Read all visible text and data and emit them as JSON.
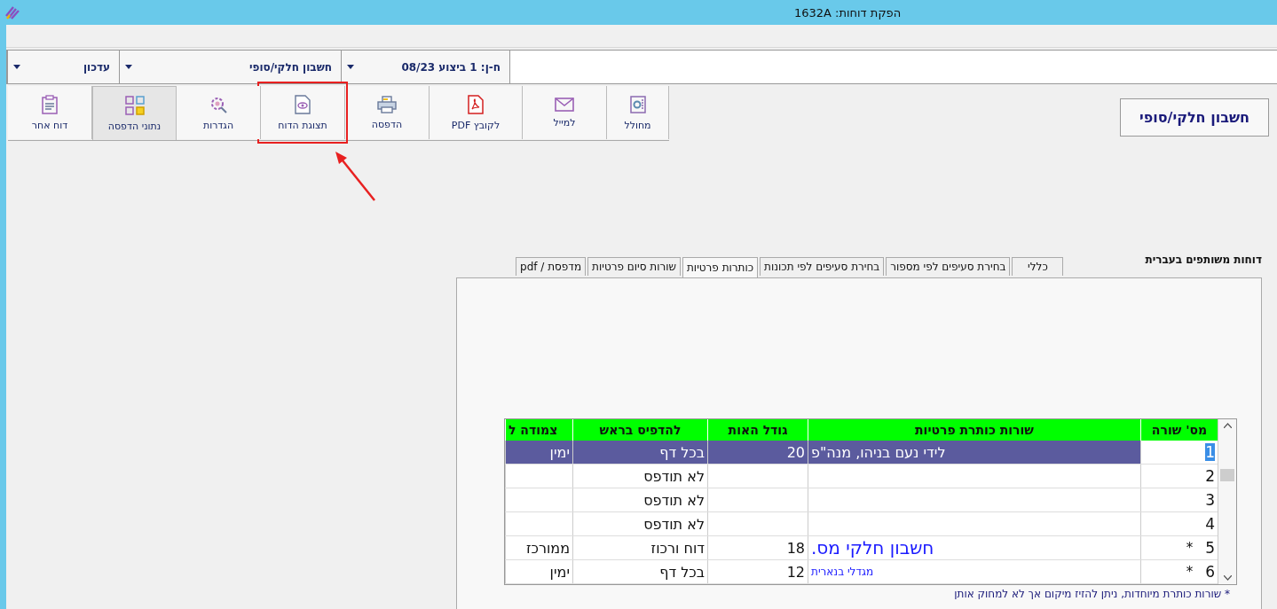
{
  "window": {
    "title": "הפקת דוחות: 1632A"
  },
  "selectors": [
    {
      "value": "ח-ן: 1 ביצוע 08/23"
    },
    {
      "value": "חשבון חלקי/סופי"
    },
    {
      "value": "עדכון"
    }
  ],
  "toolbar": [
    {
      "label": "מחולל",
      "selected": false,
      "highlighted": false
    },
    {
      "label": "למייל",
      "selected": false,
      "highlighted": false
    },
    {
      "label": "PDF לקובץ",
      "selected": false,
      "highlighted": false
    },
    {
      "label": "הדפסה",
      "selected": false,
      "highlighted": false
    },
    {
      "label": "תצוגת הדוח",
      "selected": false,
      "highlighted": true
    },
    {
      "label": "הגדרות",
      "selected": false,
      "highlighted": false
    },
    {
      "label": "נתוני הדפסה",
      "selected": true,
      "highlighted": false
    },
    {
      "label": "דוח אחר",
      "selected": false,
      "highlighted": false
    }
  ],
  "mode_button": "חשבון חלקי/סופי",
  "section_label": "דוחות משותפים בעברית",
  "tabs": [
    {
      "label": "כללי",
      "selected": false
    },
    {
      "label": "בחירת סעיפים לפי מספור",
      "selected": false
    },
    {
      "label": "בחירת סעיפים לפי תכונות",
      "selected": false
    },
    {
      "label": "כותרות פרטיות",
      "selected": true
    },
    {
      "label": "שורות סיום פרטיות",
      "selected": false
    },
    {
      "label": "מדפסת / pdf",
      "selected": false
    }
  ],
  "table": {
    "columns": [
      "מס' שורה",
      "שורות כותרת פרטיות",
      "גודל האות",
      "להדפיס בראש",
      "צמודה ל"
    ],
    "rows": [
      {
        "number": "1",
        "marker": "",
        "title": "לידי נעם בניהו, מנה\"פ",
        "kind": "plain",
        "font_size": "20",
        "print_at_top": "בכל דף",
        "align": "ימין",
        "selected": true
      },
      {
        "number": "2",
        "marker": "",
        "title": "",
        "kind": "plain",
        "font_size": "",
        "print_at_top": "לא תודפס",
        "align": "",
        "selected": false
      },
      {
        "number": "3",
        "marker": "",
        "title": "",
        "kind": "plain",
        "font_size": "",
        "print_at_top": "לא תודפס",
        "align": "",
        "selected": false
      },
      {
        "number": "4",
        "marker": "",
        "title": "",
        "kind": "plain",
        "font_size": "",
        "print_at_top": "לא תודפס",
        "align": "",
        "selected": false
      },
      {
        "number": "5",
        "marker": "*",
        "title": "חשבון חלקי מס.",
        "kind": "large",
        "font_size": "18",
        "print_at_top": "דוח ורכוז",
        "align": "ממורכז",
        "selected": false
      },
      {
        "number": "6",
        "marker": "*",
        "title": "מגדלי בנארית",
        "kind": "small",
        "font_size": "12",
        "print_at_top": "בכל דף",
        "align": "ימין",
        "selected": false
      }
    ]
  },
  "footnote": "* שורות כותרת מיוחדות, ניתן להזיז מיקום אך לא למחוק אותן"
}
